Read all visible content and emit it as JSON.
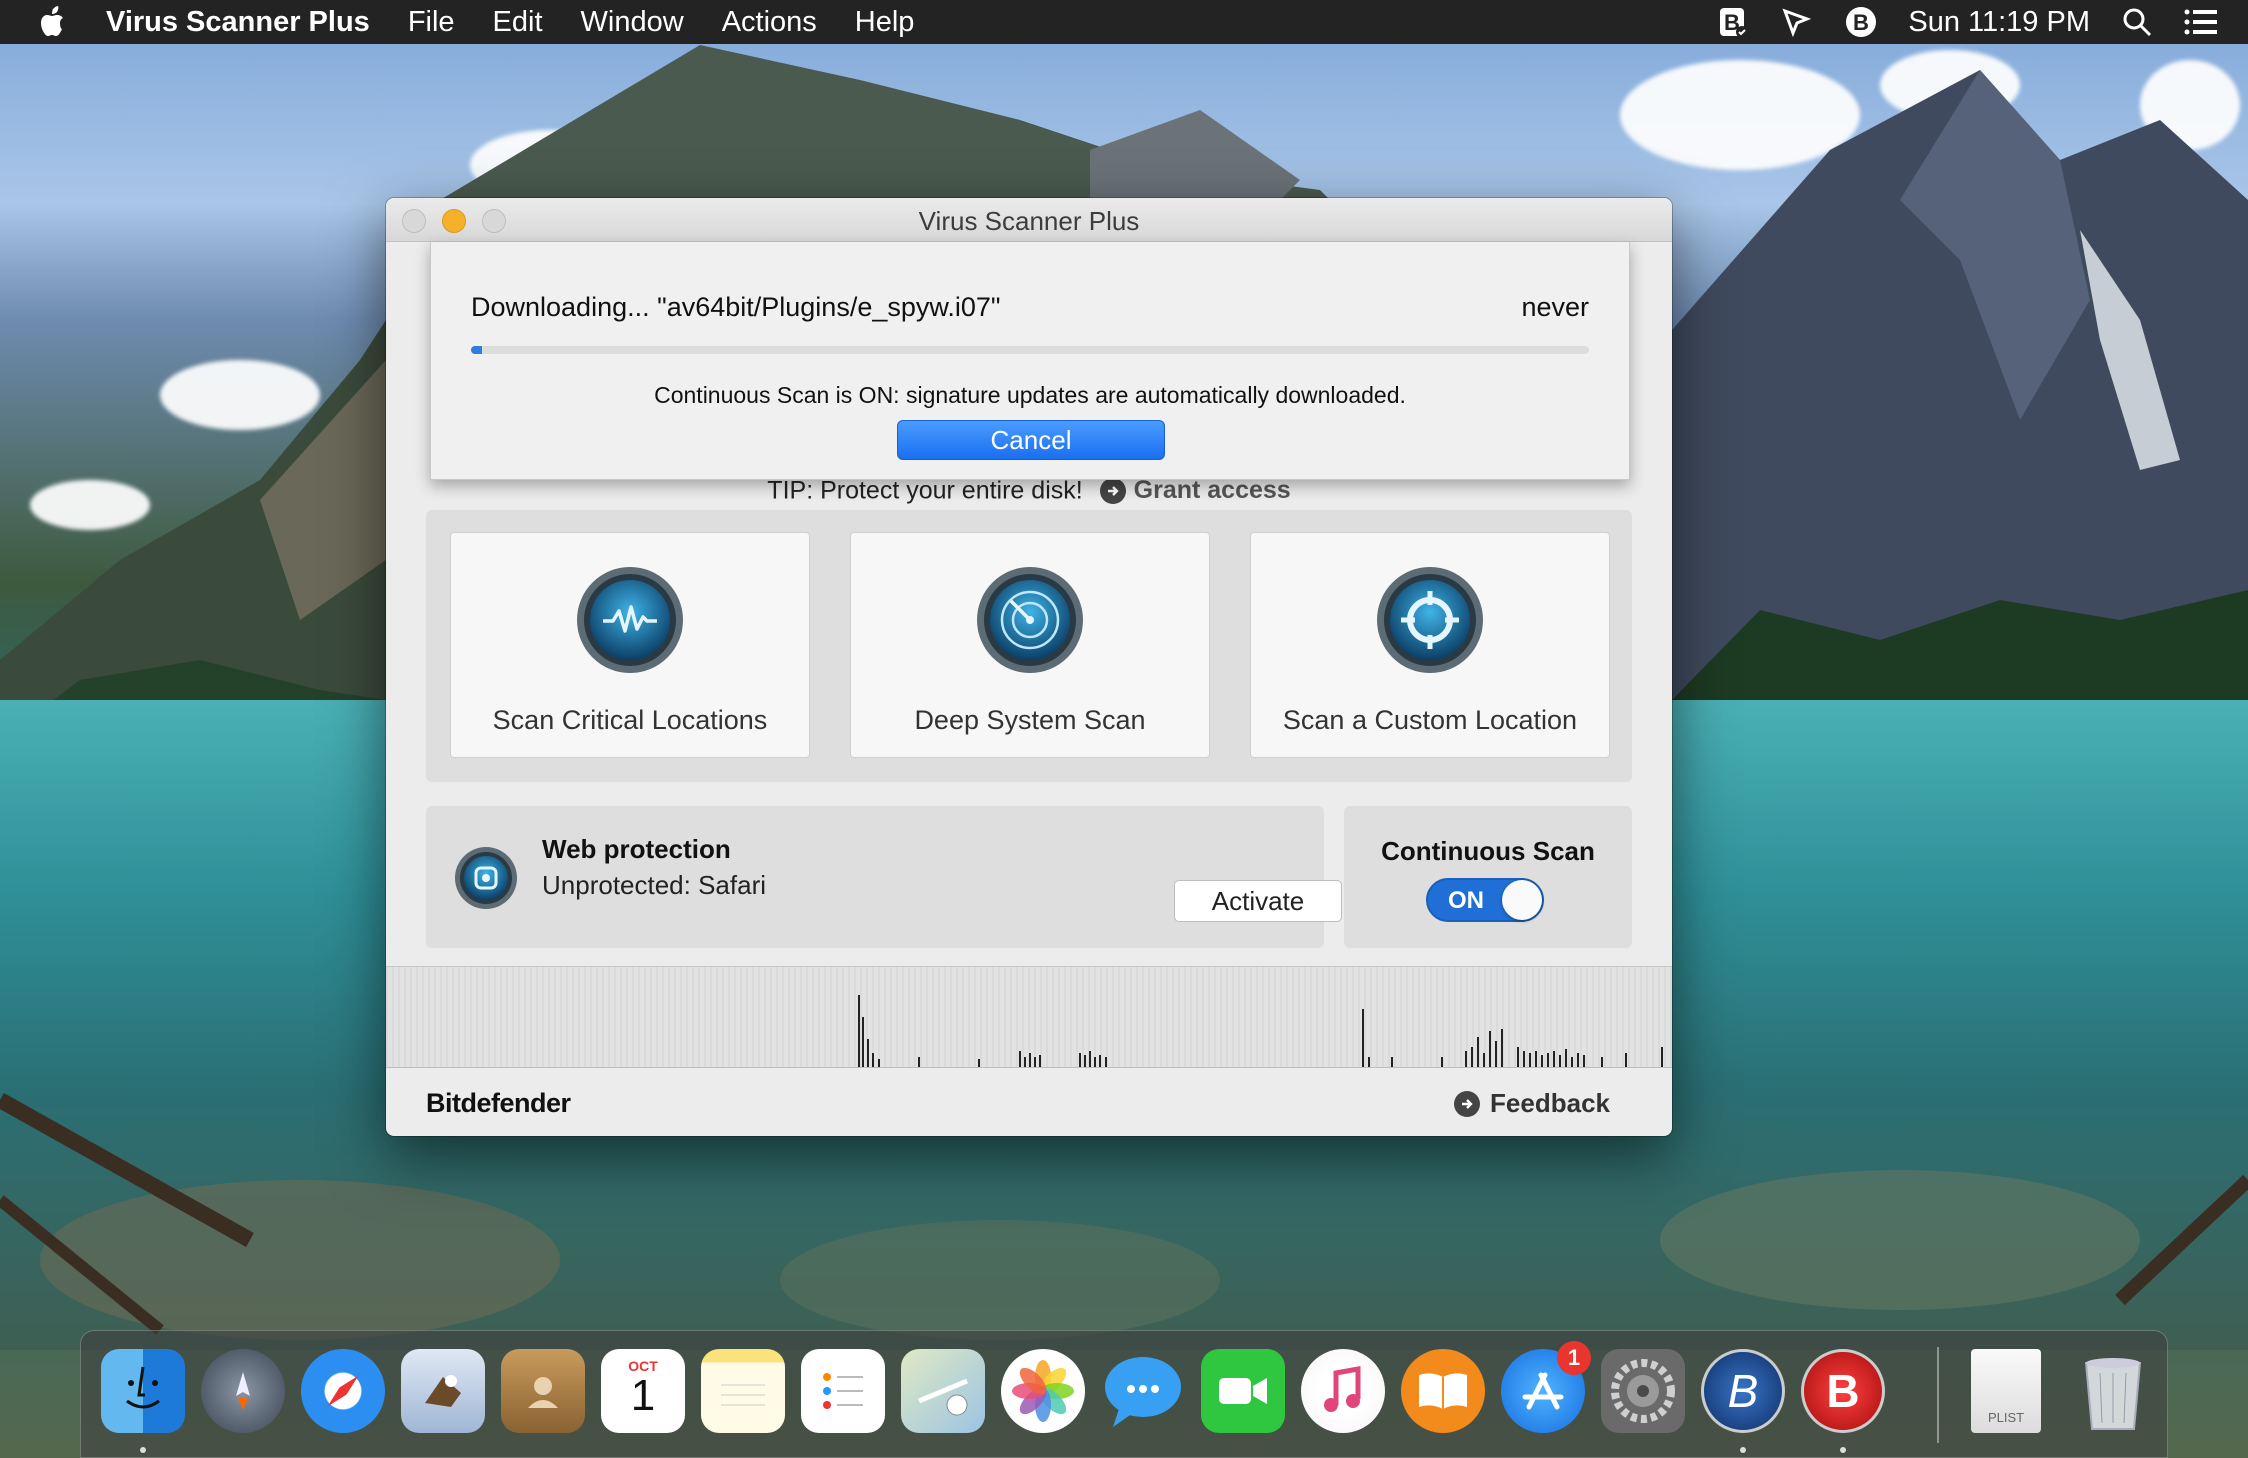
{
  "menubar": {
    "app_name": "Virus Scanner Plus",
    "items": [
      "File",
      "Edit",
      "Window",
      "Actions",
      "Help"
    ],
    "clock": "Sun 11:19 PM"
  },
  "window": {
    "title": "Virus Scanner Plus",
    "download": {
      "text": "Downloading... \"av64bit/Plugins/e_spyw.i07\"",
      "eta": "never",
      "progress_percent": 1,
      "message": "Continuous Scan is ON: signature updates are automatically downloaded.",
      "cancel_label": "Cancel"
    },
    "tip": {
      "text": "TIP: Protect your entire disk!",
      "link": "Grant access"
    },
    "scans": [
      {
        "label": "Scan Critical Locations",
        "icon": "pulse-icon"
      },
      {
        "label": "Deep System Scan",
        "icon": "radar-icon"
      },
      {
        "label": "Scan a Custom Location",
        "icon": "target-icon"
      }
    ],
    "web_protection": {
      "title": "Web protection",
      "status": "Unprotected: Safari",
      "activate_label": "Activate"
    },
    "continuous_scan": {
      "title": "Continuous Scan",
      "toggle_label": "ON"
    },
    "footer": {
      "brand": "Bitdefender",
      "feedback": "Feedback"
    }
  },
  "dock": {
    "calendar_month": "OCT",
    "calendar_day": "1",
    "app_store_badge": "1",
    "plist_label": "PLIST",
    "items": [
      "finder-icon",
      "launchpad-icon",
      "safari-icon",
      "mail-icon",
      "contacts-icon",
      "calendar-icon",
      "notes-icon",
      "reminders-icon",
      "maps-icon",
      "photos-icon",
      "messages-icon",
      "facetime-icon",
      "itunes-icon",
      "ibooks-icon",
      "app-store-icon",
      "system-preferences-icon",
      "bitdefender-b-icon",
      "bitdefender-red-icon",
      "plist-file-icon",
      "trash-icon"
    ]
  },
  "colors": {
    "accent": "#1f6fd6",
    "menubar": "#232323",
    "window_bg": "#ececec"
  }
}
